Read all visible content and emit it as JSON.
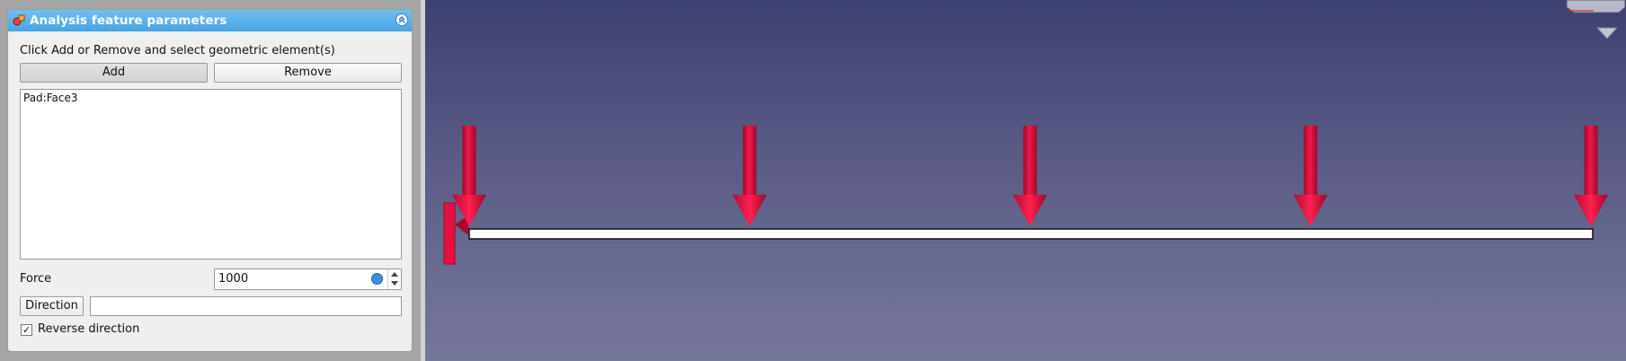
{
  "panel": {
    "title": "Analysis feature parameters",
    "instruction": "Click Add or Remove and select geometric element(s)",
    "add_label": "Add",
    "remove_label": "Remove",
    "references": [
      "Pad:Face3"
    ],
    "force_label": "Force",
    "force_value": "1000",
    "direction_label": "Direction",
    "direction_value": "",
    "reverse_label": "Reverse direction",
    "reverse_checked": true,
    "check_glyph": "✓"
  },
  "viewport": {
    "background_top": "#3d4070",
    "background_bottom": "#76789a",
    "load_arrow_color": "#e8103f",
    "fixed_constraint_color": "#e8103f",
    "load_arrow_count": 5,
    "beam_color": "#ffffff"
  },
  "icons": [
    "fem-logo-icon",
    "collapse-chevron-icon",
    "expression-gear-icon",
    "spin-up-icon",
    "spin-down-icon",
    "navigation-cube-icon",
    "navigation-down-arrow-icon"
  ]
}
